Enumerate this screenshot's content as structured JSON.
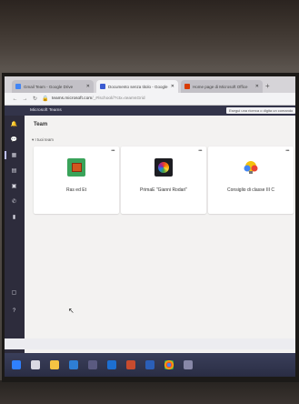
{
  "browser": {
    "tabs": [
      {
        "label": "Gmail Team - Google Drive",
        "color": "#4285f4"
      },
      {
        "label": "Documento senza titolo - Google",
        "color": "#3b5bd1"
      },
      {
        "label": "Home page di Microsoft Office",
        "color": "#d83b01"
      }
    ],
    "url_host": "teams.microsoft.com",
    "url_path": "/_#/school//?ctx=teamsGrid"
  },
  "app": {
    "title": "Microsoft Teams",
    "search_placeholder": "Esegui una ricerca o digita un comando"
  },
  "page": {
    "title": "Team",
    "section_label": "I tuoi team"
  },
  "teams": [
    {
      "name": "Ras ed Et",
      "icon": "pixel-tile-icon"
    },
    {
      "name": "PrimaE \"Gianni Rodari\"",
      "icon": "color-wheel-icon"
    },
    {
      "name": "Consiglio di classe III C",
      "icon": "lightbulb-icon"
    }
  ]
}
